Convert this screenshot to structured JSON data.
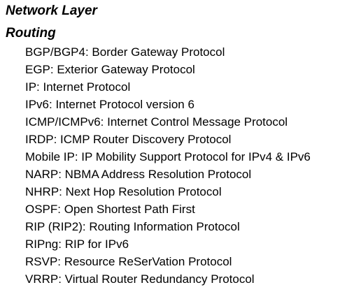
{
  "section_title": "Network Layer",
  "subsection_title": "Routing",
  "protocols": [
    "BGP/BGP4: Border Gateway Protocol",
    "EGP: Exterior Gateway Protocol",
    "IP: Internet Protocol",
    "IPv6: Internet Protocol version 6",
    "ICMP/ICMPv6: Internet Control Message Protocol",
    "IRDP: ICMP Router Discovery Protocol",
    "Mobile IP: IP Mobility Support Protocol for IPv4 & IPv6",
    "NARP: NBMA Address Resolution Protocol",
    "NHRP: Next Hop Resolution Protocol",
    "OSPF: Open Shortest Path First",
    "RIP (RIP2): Routing Information Protocol",
    "RIPng: RIP for IPv6",
    "RSVP: Resource ReSerVation Protocol",
    "VRRP: Virtual Router Redundancy Protocol"
  ]
}
